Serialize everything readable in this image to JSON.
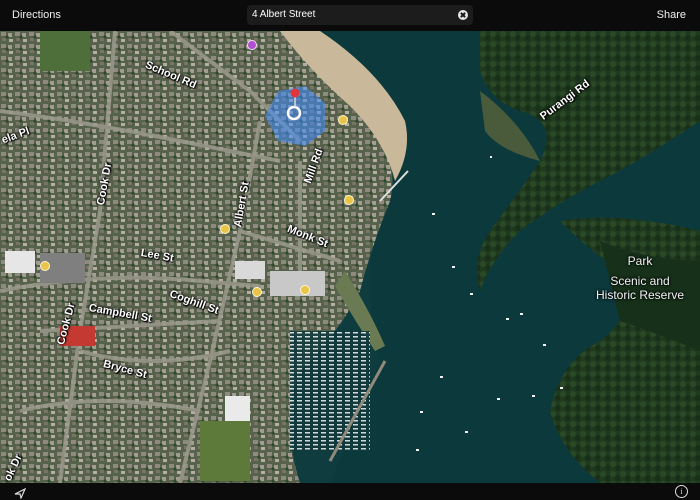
{
  "toolbar": {
    "directions_label": "Directions",
    "share_label": "Share",
    "search": {
      "value": "4 Albert Street",
      "clear_icon": "clear-icon"
    }
  },
  "bottombar": {
    "locate_icon": "location-arrow-icon",
    "info_label": "i"
  },
  "map": {
    "type": "satellite",
    "streets": {
      "school_rd": "School Rd",
      "albert_st": "Albert St",
      "mill_rd": "Mill Rd",
      "monk_st": "Monk St",
      "lee_st": "Lee St",
      "coghill_st": "Coghill St",
      "campbell_st": "Campbell St",
      "bryce_st": "Bryce St",
      "cook_dr_north": "Cook Dr",
      "cook_dr_south": "Cook Dr",
      "purangi_rd": "Purangi Rd",
      "ela_pl": "ela Pl",
      "bottom_left": "ok Dr"
    },
    "park": {
      "line1": "Park",
      "line2": "Scenic and",
      "line3": "Historic Reserve"
    },
    "colors": {
      "water": "#0f3d3f",
      "land": "#4e5a45",
      "forest": "#1f3a1f",
      "beach": "#c9b99a",
      "pin": "#e0353b",
      "location": "#3f8cff"
    }
  }
}
